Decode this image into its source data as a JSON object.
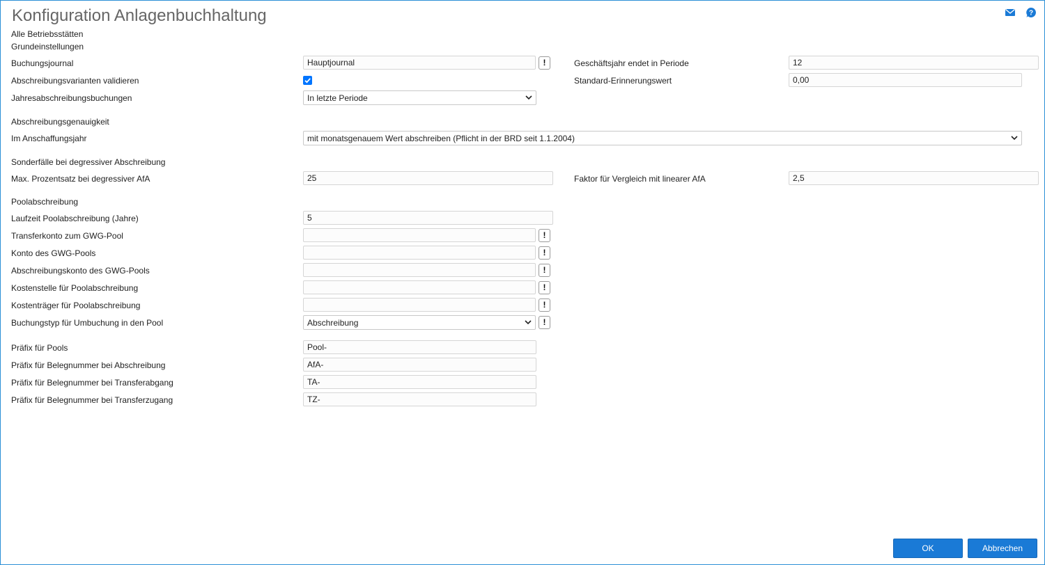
{
  "header": {
    "title": "Konfiguration Anlagenbuchhaltung",
    "subtitle": "Alle Betriebsstätten",
    "section": "Grundeinstellungen",
    "icons": [
      "mail-icon",
      "help-icon"
    ]
  },
  "colors": {
    "accent": "#1a7ad6",
    "border": "#2a8fd6",
    "checkbox": "#0075ff"
  },
  "grund": {
    "buchungsjournal_label": "Buchungsjournal",
    "buchungsjournal_value": "Hauptjournal",
    "validieren_label": "Abschreibungsvarianten validieren",
    "validieren_checked": true,
    "jahres_label": "Jahresabschreibungsbuchungen",
    "jahres_value": "In letzte Periode",
    "geschaeftsjahr_label": "Geschäftsjahr endet in Periode",
    "geschaeftsjahr_value": "12",
    "erinnerung_label": "Standard-Erinnerungswert",
    "erinnerung_value": "0,00"
  },
  "genauigkeit": {
    "heading": "Abschreibungsgenauigkeit",
    "anschaffung_label": "Im Anschaffungsjahr",
    "anschaffung_value": "mit monatsgenauem Wert abschreiben (Pflicht in der BRD seit 1.1.2004)"
  },
  "degressiv": {
    "heading": "Sonderfälle bei degressiver Abschreibung",
    "max_label": "Max. Prozentsatz bei degressiver AfA",
    "max_value": "25",
    "faktor_label": "Faktor für Vergleich mit linearer AfA",
    "faktor_value": "2,5"
  },
  "pool": {
    "heading": "Poolabschreibung",
    "laufzeit_label": "Laufzeit Poolabschreibung (Jahre)",
    "laufzeit_value": "5",
    "transferkonto_label": "Transferkonto zum GWG-Pool",
    "transferkonto_value": "",
    "konto_label": "Konto des GWG-Pools",
    "konto_value": "",
    "abschreibungskonto_label": "Abschreibungskonto des GWG-Pools",
    "abschreibungskonto_value": "",
    "kostenstelle_label": "Kostenstelle für Poolabschreibung",
    "kostenstelle_value": "",
    "kostentraeger_label": "Kostenträger für Poolabschreibung",
    "kostentraeger_value": "",
    "buchungstyp_label": "Buchungstyp für Umbuchung in den Pool",
    "buchungstyp_value": "Abschreibung"
  },
  "praefix": {
    "pools_label": "Präfix für Pools",
    "pools_value": "Pool-",
    "abschreibung_label": "Präfix für Belegnummer bei Abschreibung",
    "abschreibung_value": "AfA-",
    "transferabgang_label": "Präfix für Belegnummer bei Transferabgang",
    "transferabgang_value": "TA-",
    "transferzugang_label": "Präfix für Belegnummer bei Transferzugang",
    "transferzugang_value": "TZ-"
  },
  "info_button_label": "!",
  "footer": {
    "ok_label": "OK",
    "cancel_label": "Abbrechen"
  }
}
